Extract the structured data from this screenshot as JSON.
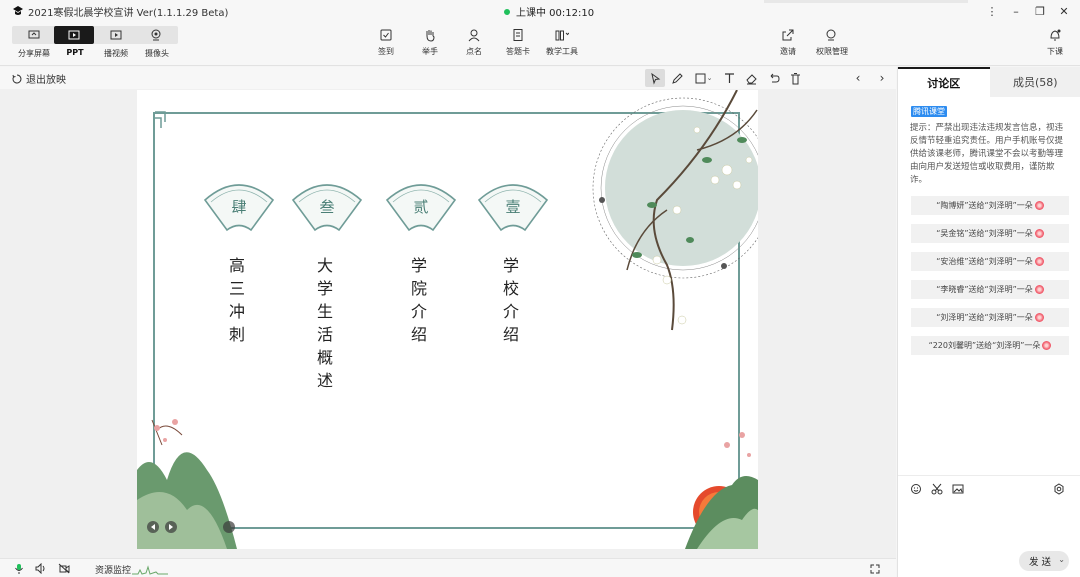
{
  "window": {
    "title": "2021寒假北晨学校宣讲 Ver(1.1.1.29 Beta)",
    "status": "上课中 00:12:10"
  },
  "toolbar": {
    "modes": [
      {
        "label": "分享屏幕",
        "icon": "screen-share-icon"
      },
      {
        "label": "PPT",
        "icon": "ppt-icon"
      },
      {
        "label": "播视频",
        "icon": "video-play-icon"
      },
      {
        "label": "摄像头",
        "icon": "camera-icon"
      }
    ],
    "tools": [
      {
        "label": "签到",
        "icon": "check-in-icon"
      },
      {
        "label": "举手",
        "icon": "raise-hand-icon"
      },
      {
        "label": "点名",
        "icon": "roll-call-icon"
      },
      {
        "label": "答题卡",
        "icon": "answer-card-icon"
      },
      {
        "label": "教学工具",
        "icon": "teaching-tools-icon"
      },
      {
        "label": "邀请",
        "icon": "invite-icon"
      },
      {
        "label": "权限管理",
        "icon": "permission-icon"
      },
      {
        "label": "下课",
        "icon": "end-class-icon"
      }
    ]
  },
  "subbar": {
    "exit_label": "退出放映"
  },
  "slide": {
    "sections": [
      {
        "numeral": "肆",
        "text": "高三冲刺"
      },
      {
        "numeral": "叁",
        "text": "大学生活概述"
      },
      {
        "numeral": "贰",
        "text": "学院介绍"
      },
      {
        "numeral": "壹",
        "text": "学校介绍"
      }
    ]
  },
  "bottombar": {
    "resource_label": "资源监控"
  },
  "panel": {
    "tabs": [
      {
        "label": "讨论区",
        "active": true
      },
      {
        "label": "成员(58)",
        "active": false
      }
    ],
    "badge": "腾讯课堂",
    "notice": "提示：严禁出现违法违规发言信息，视违反情节轻重追究责任。用户手机账号仅提供给该课老师，腾讯课堂不会以考勤等理由向用户发送短信或收取费用，谨防欺诈。",
    "gifts": [
      "“陶博妍”送给“刘泽明”一朵",
      "“吴金铭”送给“刘泽明”一朵",
      "“安治维”送给“刘泽明”一朵",
      "“李晓睿”送给“刘泽明”一朵",
      "“刘泽明”送给“刘泽明”一朵",
      "“220刘馨明”送给“刘泽明”一朵"
    ],
    "send_label": "发 送"
  },
  "colors": {
    "accent": "#20c05c",
    "dark": "#1a1a1a",
    "frame": "#6f9c97",
    "badge": "#2d8cf0"
  }
}
